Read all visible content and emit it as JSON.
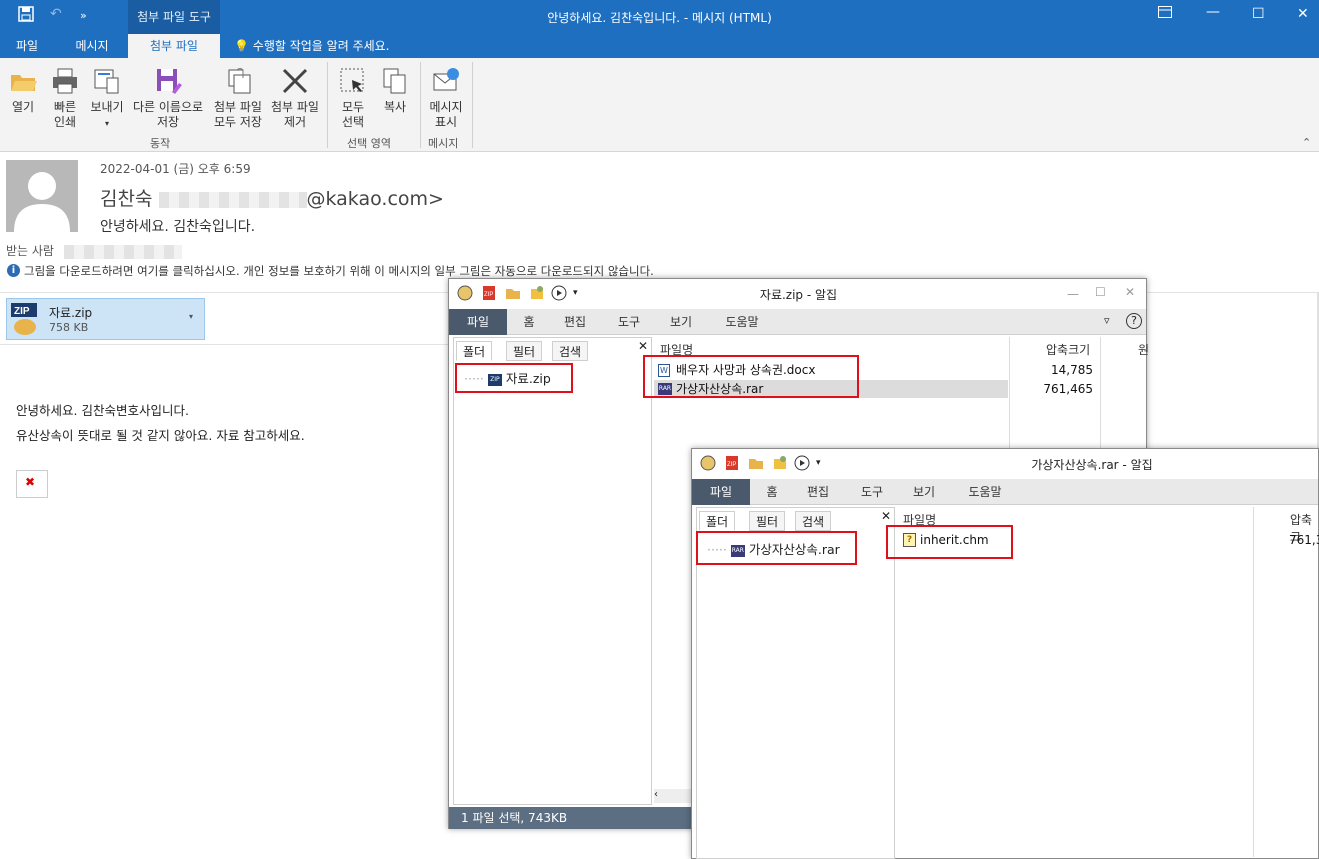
{
  "outlook": {
    "context_tab": "첨부 파일 도구",
    "window_title": "안녕하세요. 김찬숙입니다. - 메시지 (HTML)",
    "tabs": [
      "파일",
      "메시지",
      "첨부 파일"
    ],
    "tell_me": "수행할 작업을 알려 주세요.",
    "ribbon": {
      "open": "열기",
      "quick_print_1": "빠른",
      "quick_print_2": "인쇄",
      "send": "보내기",
      "save_as_1": "다른 이름으로",
      "save_as_2": "저장",
      "save_all_1": "첨부 파일",
      "save_all_2": "모두 저장",
      "remove_1": "첨부 파일",
      "remove_2": "제거",
      "select_all_1": "모두",
      "select_all_2": "선택",
      "copy": "복사",
      "show_msg_1": "메시지",
      "show_msg_2": "표시",
      "group_action": "동작",
      "group_selection": "선택 영역",
      "group_message": "메시지"
    },
    "message": {
      "date": "2022-04-01 (금) 오후 6:59",
      "sender_name": "김찬숙",
      "sender_email_domain": "@kakao.com>",
      "subject": "안녕하세요. 김찬숙입니다.",
      "to_label": "받는 사람",
      "info": "그림을 다운로드하려면 여기를 클릭하십시오. 개인 정보를 보호하기 위해 이 메시지의 일부 그림은 자동으로 다운로드되지 않습니다.",
      "attachment_name": "자료.zip",
      "attachment_size": "758 KB",
      "body_line1": "안녕하세요. 김찬숙변호사입니다.",
      "body_line2": "유산상속이 뜻대로 될 것 같지 않아요. 자료 참고하세요."
    }
  },
  "alzip1": {
    "title": "자료.zip - 알집",
    "tabs": [
      "파일",
      "홈",
      "편집",
      "도구",
      "보기",
      "도움말"
    ],
    "folder_tabs": [
      "폴더",
      "필터",
      "검색"
    ],
    "folder_item": "자료.zip",
    "col_name": "파일명",
    "col_size": "압축크기",
    "col_orig": "원",
    "files": [
      {
        "name": "배우자 사망과 상속권.docx",
        "size": "14,785"
      },
      {
        "name": "가상자산상속.rar",
        "size": "761,465"
      }
    ],
    "status": "1 파일 선택,  743KB"
  },
  "alzip2": {
    "title": "가상자산상속.rar - 알집",
    "tabs": [
      "파일",
      "홈",
      "편집",
      "도구",
      "보기",
      "도움말"
    ],
    "folder_tabs": [
      "폴더",
      "필터",
      "검색"
    ],
    "folder_item": "가상자산상속.rar",
    "col_name": "파일명",
    "col_size": "압축크",
    "files": [
      {
        "name": "inherit.chm",
        "size": "761,3"
      }
    ]
  },
  "colors": {
    "outlook_blue": "#1f6fc0",
    "attach_bg": "#cde4f7",
    "alzip_active_tab": "#4a5a6c",
    "highlight_red": "#e0101a"
  }
}
